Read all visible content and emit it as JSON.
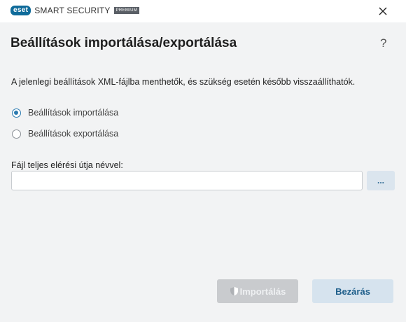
{
  "titlebar": {
    "logo_text": "eset",
    "product_name": "SMART SECURITY",
    "edition_badge": "PREMIUM"
  },
  "dialog": {
    "title": "Beállítások importálása/exportálása",
    "help_label": "?",
    "description": "A jelenlegi beállítások XML-fájlba menthetők, és szükség esetén később visszaállíthatók.",
    "options": [
      {
        "label": "Beállítások importálása",
        "selected": true
      },
      {
        "label": "Beállítások exportálása",
        "selected": false
      }
    ],
    "file_path_label": "Fájl teljes elérési útja névvel:",
    "file_path_value": "",
    "browse_label": "...",
    "import_label": "Importálás",
    "import_enabled": false,
    "close_label": "Bezárás"
  },
  "colors": {
    "accent": "#2a7ab0",
    "brand": "#0f6b9a",
    "background": "#f2f3f4",
    "disabled_button": "#c9cbce",
    "secondary_button": "#d6e3ee"
  },
  "icons": {
    "close": "close-icon",
    "shield": "shield-icon"
  }
}
